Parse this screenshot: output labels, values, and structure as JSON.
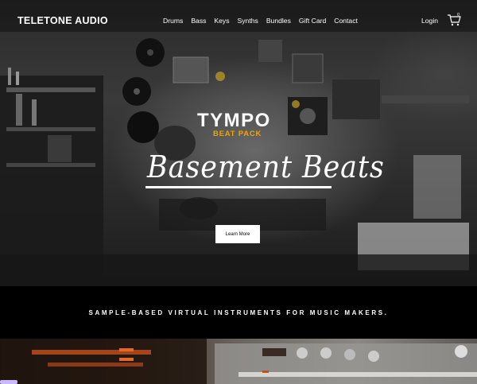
{
  "header": {
    "logo": "TELETONE AUDIO",
    "nav": [
      "Drums",
      "Bass",
      "Keys",
      "Synths",
      "Bundles",
      "Gift Card",
      "Contact"
    ],
    "login": "Login",
    "cart_count": "0"
  },
  "hero": {
    "brand_title": "TYMPO",
    "brand_subtitle": "BEAT PACK",
    "script_title": "Basement Beats",
    "cta": "Learn More"
  },
  "strip": {
    "tagline": "SAMPLE-BASED VIRTUAL INSTRUMENTS FOR MUSIC MAKERS."
  },
  "colors": {
    "accent": "#f0a500",
    "background": "#000000",
    "button_bg": "#ffffff"
  },
  "icons": {
    "cart": "cart-icon"
  }
}
